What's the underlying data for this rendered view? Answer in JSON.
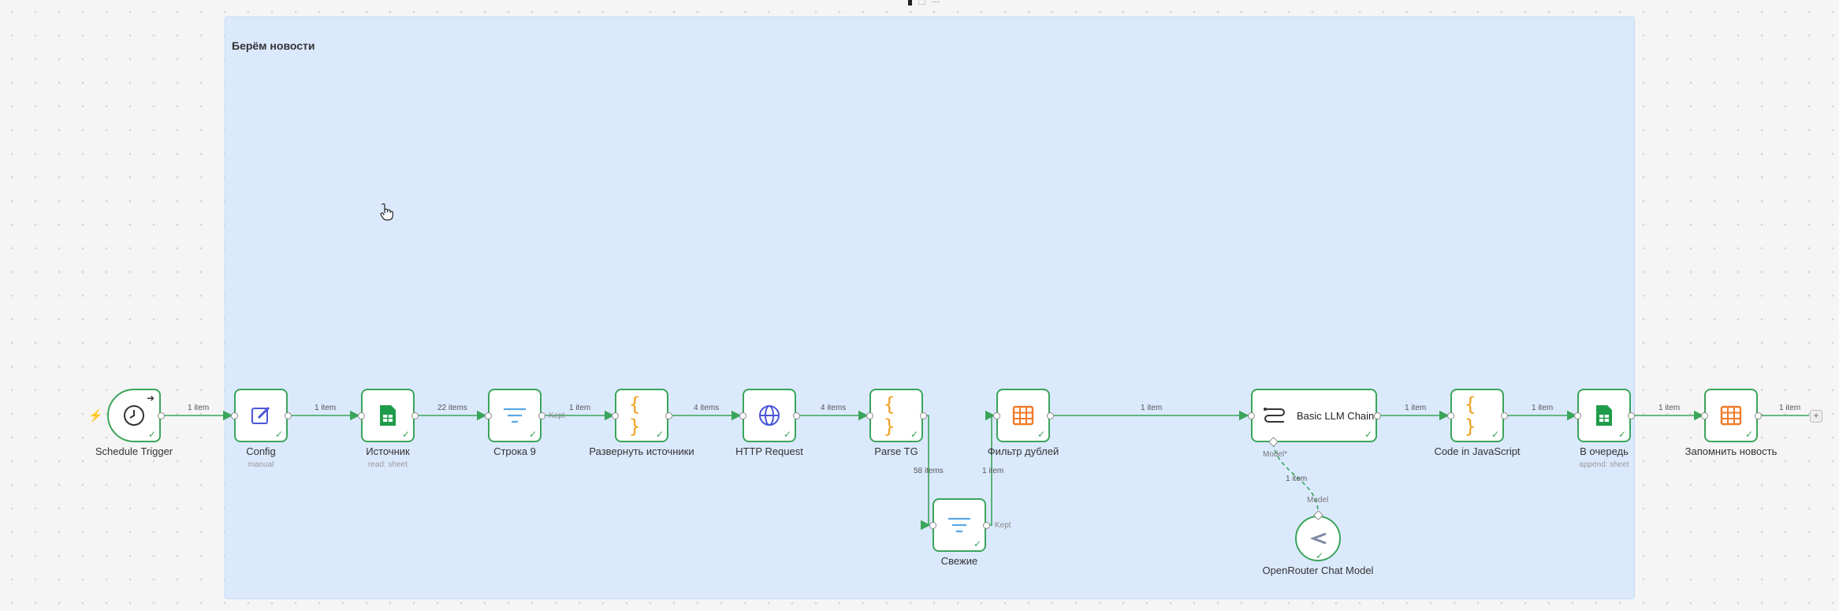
{
  "sticky": {
    "title": "Берём новости"
  },
  "nodes": {
    "schedule": {
      "label": "Schedule Trigger"
    },
    "config": {
      "label": "Config",
      "sub": "manual"
    },
    "source": {
      "label": "Источник",
      "sub": "read: sheet"
    },
    "row9": {
      "label": "Строка 9"
    },
    "expand": {
      "label": "Развернуть источники"
    },
    "http": {
      "label": "HTTP Request"
    },
    "parse": {
      "label": "Parse TG"
    },
    "fresh": {
      "label": "Свежие"
    },
    "dedup": {
      "label": "Фильтр дублей"
    },
    "llm": {
      "label": "Basic LLM Chain"
    },
    "openrouter": {
      "label": "OpenRouter Chat Model"
    },
    "code": {
      "label": "Code in JavaScript"
    },
    "queue": {
      "label": "В очередь",
      "sub": "append: sheet"
    },
    "remember": {
      "label": "Запомнить новость"
    }
  },
  "edges": {
    "e1": "1 item",
    "e2": "1 item",
    "e3": "22 items",
    "e4": "1 item",
    "e5": "4 items",
    "e6": "4 items",
    "e7": "58 items",
    "e8": "1 item",
    "e9": "1 item",
    "e10": "1 item",
    "e11": "1 item",
    "e12": "1 item",
    "e13": "1 item",
    "e14": "1 item",
    "kept1": "Kept",
    "kept2": "Kept",
    "model_out": "Model*",
    "model_in": "Model"
  },
  "colors": {
    "success": "#3aa55a",
    "sticky": "#dbe9fd",
    "code": "#f0a020",
    "sheets": "#1e9c4a",
    "table": "#f07b2a",
    "filter": "#5aa7e6"
  }
}
